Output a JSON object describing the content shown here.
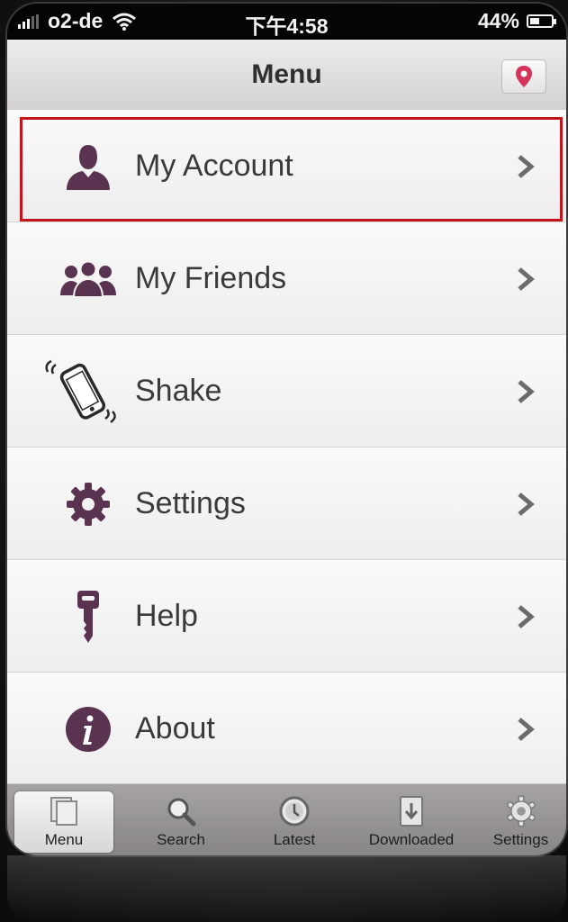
{
  "status_bar": {
    "carrier": "o2-de",
    "time": "下午4:58",
    "battery": "44%",
    "battery_level": 0.44
  },
  "nav": {
    "title": "Menu",
    "pin_icon": "map-pin-icon",
    "accent": "#d6335a"
  },
  "menu": {
    "items": [
      {
        "label": "My Account",
        "icon": "person-icon",
        "highlighted": true
      },
      {
        "label": "My Friends",
        "icon": "group-icon"
      },
      {
        "label": "Shake",
        "icon": "phone-shake-icon"
      },
      {
        "label": "Settings",
        "icon": "gear-icon"
      },
      {
        "label": "Help",
        "icon": "key-icon"
      },
      {
        "label": "About",
        "icon": "info-icon"
      }
    ],
    "icon_color": "#5a3350",
    "highlight_color": "#c2141c"
  },
  "tabbar": {
    "tabs": [
      {
        "label": "Menu",
        "icon": "menu-pages-icon",
        "active": true
      },
      {
        "label": "Search",
        "icon": "magnifier-icon"
      },
      {
        "label": "Latest",
        "icon": "clock-icon"
      },
      {
        "label": "Downloaded",
        "icon": "download-icon"
      },
      {
        "label": "Settings",
        "icon": "gear-icon"
      }
    ]
  }
}
